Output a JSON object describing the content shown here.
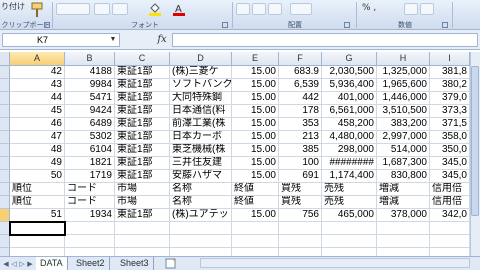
{
  "ribbon": {
    "clipboard_label": "クリップボード",
    "font_label": "フォント",
    "alignment_label": "配置",
    "number_label": "数値",
    "top_left_text": "り付け",
    "number_format_text": "% ,"
  },
  "formula_bar": {
    "name_box": "K7",
    "fx": "fx",
    "formula": ""
  },
  "columns": [
    "A",
    "B",
    "C",
    "D",
    "E",
    "F",
    "G",
    "H",
    "I"
  ],
  "rows": [
    [
      "42",
      "4188",
      "東証1部",
      "(株)三菱ケ",
      "15.00",
      "683.9",
      "2,030,500",
      "1,325,000",
      "381,8"
    ],
    [
      "43",
      "9984",
      "東証1部",
      "ソフトバンク",
      "15.00",
      "6,539",
      "5,936,400",
      "1,965,600",
      "380,2"
    ],
    [
      "44",
      "5471",
      "東証1部",
      "大同特殊鋼",
      "15.00",
      "442",
      "401,000",
      "1,446,000",
      "379,0"
    ],
    [
      "45",
      "9424",
      "東証1部",
      "日本通信(料",
      "15.00",
      "178",
      "6,561,000",
      "3,510,500",
      "373,3"
    ],
    [
      "46",
      "6489",
      "東証1部",
      "前澤工業(株",
      "15.00",
      "353",
      "458,200",
      "383,200",
      "371,5"
    ],
    [
      "47",
      "5302",
      "東証1部",
      "日本カーボ",
      "15.00",
      "213",
      "4,480,000",
      "2,997,000",
      "358,0"
    ],
    [
      "48",
      "6104",
      "東証1部",
      "東芝機械(株",
      "15.00",
      "385",
      "298,000",
      "514,000",
      "350,0"
    ],
    [
      "49",
      "1821",
      "東証1部",
      "三井住友建",
      "15.00",
      "100",
      "########",
      "1,687,300",
      "345,0"
    ],
    [
      "50",
      "1719",
      "東証1部",
      "安藤ハザマ",
      "15.00",
      "691",
      "1,174,400",
      "830,800",
      "345,0"
    ],
    [
      "順位",
      "コード",
      "市場",
      "名称",
      "終値",
      "買残",
      "売残",
      "増減",
      "信用倍"
    ],
    [
      "順位",
      "コード",
      "市場",
      "名称",
      "終値",
      "買残",
      "売残",
      "増減",
      "信用倍"
    ],
    [
      "51",
      "1934",
      "東証1部",
      "(株)ユアテッ",
      "15.00",
      "756",
      "465,000",
      "378,000",
      "342,0"
    ],
    [
      "",
      "",
      "",
      "",
      "",
      "",
      "",
      "",
      ""
    ],
    [
      "",
      "",
      "",
      "",
      "",
      "",
      "",
      "",
      ""
    ],
    [
      "",
      "",
      "",
      "",
      "",
      "",
      "",
      "",
      ""
    ]
  ],
  "sheet_tabs": [
    "DATA",
    "Sheet2",
    "Sheet3"
  ],
  "active_tab": "DATA",
  "colors": {
    "ribbon": "#dce6f3",
    "header_selected": "#f9cf72",
    "grid_line": "#d0d7e5"
  }
}
